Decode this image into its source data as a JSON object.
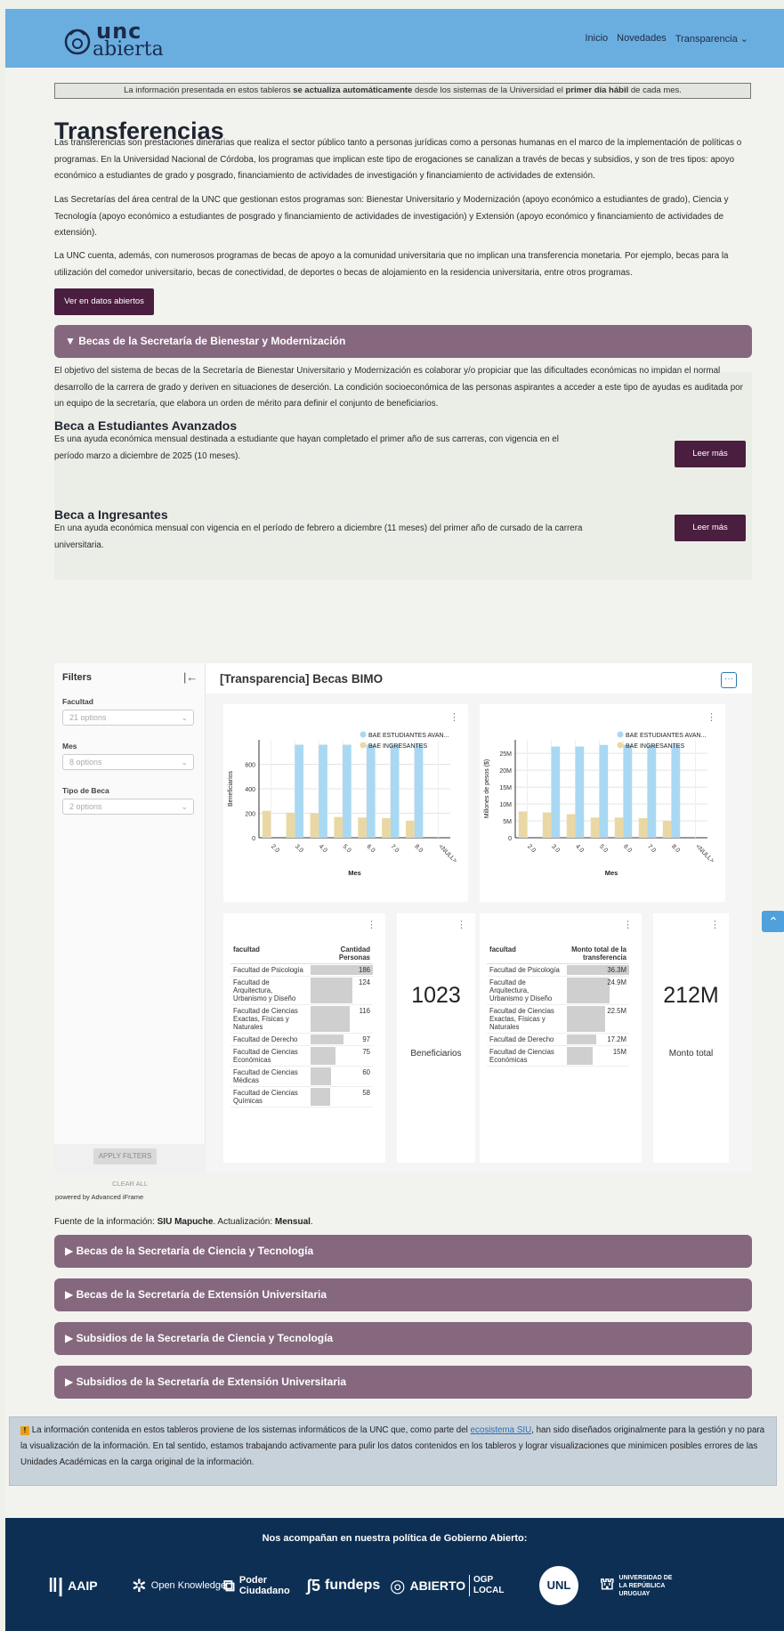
{
  "header": {
    "logo_top": "unc",
    "logo_bottom": "abierta",
    "nav": [
      "Inicio",
      "Novedades",
      "Transparencia"
    ]
  },
  "notice": {
    "pre": "La información presentada en estos tableros ",
    "bold1": "se actualiza automáticamente",
    "mid": " desde los sistemas de la Universidad el ",
    "bold2": "primer día hábil",
    "post": " de cada mes."
  },
  "page_title": "Transferencias",
  "intro": [
    "Las transferencias son prestaciones dinerarias que realiza el sector público tanto a personas jurídicas como a personas humanas en el marco de la implementación de políticas o programas. En la Universidad Nacional de Córdoba, los programas que implican este tipo de erogaciones se canalizan a través de becas y subsidios, y son de tres tipos: apoyo económico a estudiantes de grado y posgrado, financiamiento de actividades de investigación y financiamiento de actividades de extensión.",
    "Las Secretarías del área central de la UNC que gestionan estos programas son: Bienestar Universitario y Modernización (apoyo económico a estudiantes de grado), Ciencia y Tecnología (apoyo económico a estudiantes de posgrado y financiamiento de actividades de investigación) y Extensión (apoyo económico y financiamiento de actividades de extensión).",
    "La UNC cuenta, además, con numerosos programas de becas de apoyo a la comunidad universitaria que no implican una transferencia monetaria. Por ejemplo, becas para la utilización del comedor universitario, becas de conectividad, de deportes o becas de alojamiento en la residencia universitaria, entre otros programas."
  ],
  "open_data_button": "Ver en datos abiertos",
  "accordion_open": "▼ Becas de la Secretaría de Bienestar y Modernización",
  "bienestar": {
    "description": "El objetivo del sistema de becas de la Secretaría de Bienestar Universitario y Modernización es colaborar y/o propiciar que las dificultades económicas no impidan el normal desarrollo de la carrera de grado y deriven en situaciones de deserción. La condición socioeconómica de las personas aspirantes a acceder a este tipo de ayudas es auditada por un equipo de la secretaría, que elabora un orden de mérito para definir el conjunto de beneficiarios.",
    "beca1_title": "Beca a Estudiantes Avanzados",
    "beca1_text": "Es una ayuda económica mensual destinada a estudiante que hayan completado el primer año de sus carreras, con vigencia en el período marzo a diciembre de 2025 (10 meses).",
    "beca2_title": "Beca a Ingresantes",
    "beca2_text": "En una ayuda económica mensual con vigencia en el período de febrero a diciembre (11 meses) del primer año de cursado de la carrera universitaria.",
    "read_more": "Leer más"
  },
  "dashboard": {
    "title": "[Transparencia] Becas BIMO",
    "filters_title": "Filters",
    "filters": [
      {
        "label": "Facultad",
        "value": "21 options"
      },
      {
        "label": "Mes",
        "value": "8 options"
      },
      {
        "label": "Tipo de Beca",
        "value": "2 options"
      }
    ],
    "apply": "APPLY FILTERS",
    "clear": "CLEAR ALL",
    "powered": "powered by Advanced iFrame",
    "kpi1_value": "1023",
    "kpi1_label": "Beneficiarios",
    "kpi2_value": "212M",
    "kpi2_label": "Monto total",
    "table1": {
      "headers": [
        "facultad",
        "Cantidad Personas"
      ],
      "rows": [
        [
          "Facultad de Psicología",
          "186"
        ],
        [
          "Facultad de Arquitectura, Urbanismo y Diseño",
          "124"
        ],
        [
          "Facultad de Ciencias Exactas, Físicas y Naturales",
          "116"
        ],
        [
          "Facultad de Derecho",
          "97"
        ],
        [
          "Facultad de Ciencias Económicas",
          "75"
        ],
        [
          "Facultad de Ciencias Médicas",
          "60"
        ],
        [
          "Facultad de Ciencias Químicas",
          "58"
        ]
      ]
    },
    "table2": {
      "headers": [
        "facultad",
        "Monto total de la transferencia"
      ],
      "rows": [
        [
          "Facultad de Psicología",
          "36.3M"
        ],
        [
          "Facultad de Arquitectura, Urbanismo y Diseño",
          "24.9M"
        ],
        [
          "Facultad de Ciencias Exactas, Físicas y Naturales",
          "22.5M"
        ],
        [
          "Facultad de Derecho",
          "17.2M"
        ],
        [
          "Facultad de Ciencias Económicas",
          "15M"
        ]
      ]
    }
  },
  "chart_data": [
    {
      "type": "bar",
      "categories": [
        "2.0",
        "3.0",
        "4.0",
        "5.0",
        "6.0",
        "7.0",
        "8.0",
        "<NULL>"
      ],
      "series": [
        {
          "name": "BAE ESTUDIANTES AVAN...",
          "color": "#a9d8f2",
          "values": [
            null,
            760,
            760,
            760,
            760,
            760,
            760,
            null
          ]
        },
        {
          "name": "BAE INGRESANTES",
          "color": "#ead8a4",
          "values": [
            220,
            205,
            200,
            170,
            165,
            160,
            140,
            null
          ]
        }
      ],
      "xlabel": "Mes",
      "ylabel": "Beneficiarios",
      "ylim": [
        0,
        800
      ],
      "yticks": [
        "0",
        "200",
        "400",
        "600"
      ],
      "grid": true,
      "legend": "top-right"
    },
    {
      "type": "bar",
      "categories": [
        "2.0",
        "3.0",
        "4.0",
        "5.0",
        "6.0",
        "7.0",
        "8.0",
        "<NULL>"
      ],
      "series": [
        {
          "name": "BAE ESTUDIANTES AVAN...",
          "color": "#a9d8f2",
          "values": [
            null,
            27,
            27,
            27.5,
            27.5,
            27.5,
            27.5,
            null
          ]
        },
        {
          "name": "BAE INGRESANTES",
          "color": "#ead8a4",
          "values": [
            7.8,
            7.5,
            7.0,
            6.0,
            6.0,
            5.8,
            5.0,
            null
          ]
        }
      ],
      "xlabel": "Mes",
      "ylabel": "Millones de pesos ($)",
      "ylim": [
        0,
        29
      ],
      "yticks": [
        "0",
        "5M",
        "10M",
        "15M",
        "20M",
        "25M"
      ],
      "grid": true,
      "legend": "top-right"
    }
  ],
  "source": {
    "pre": "Fuente de la información: ",
    "b1": "SIU Mapuche",
    "mid": ". Actualización: ",
    "b2": "Mensual",
    "post": "."
  },
  "accordions": [
    "▶ Becas de la Secretaría de Ciencia y Tecnología",
    "▶ Becas de la Secretaría de Extensión Universitaria",
    "▶ Subsidios de la Secretaría de Ciencia y Tecnología",
    "▶ Subsidios de la Secretaría de Extensión Universitaria"
  ],
  "warning": {
    "pre": " La información contenida en estos tableros proviene de los sistemas informáticos de la UNC que, como parte del ",
    "link": "ecosistema SIU",
    "post": ", han sido diseñados originalmente para la gestión y no para la visualización de la información. En tal sentido, estamos trabajando activamente para pulir los datos contenidos en los tableros y lograr visualizaciones que minimicen posibles errores de las Unidades Académicas en la carga original de la información."
  },
  "footer": {
    "title": "Nos acompañan en nuestra política de Gobierno Abierto:",
    "partners": [
      "AAIP",
      "Open Knowledge",
      "Poder Ciudadano",
      "fundeps",
      "ABIERTO",
      "OGP LOCAL",
      "UNL",
      "UNIVERSIDAD DE LA REPÚBLICA URUGUAY"
    ]
  }
}
